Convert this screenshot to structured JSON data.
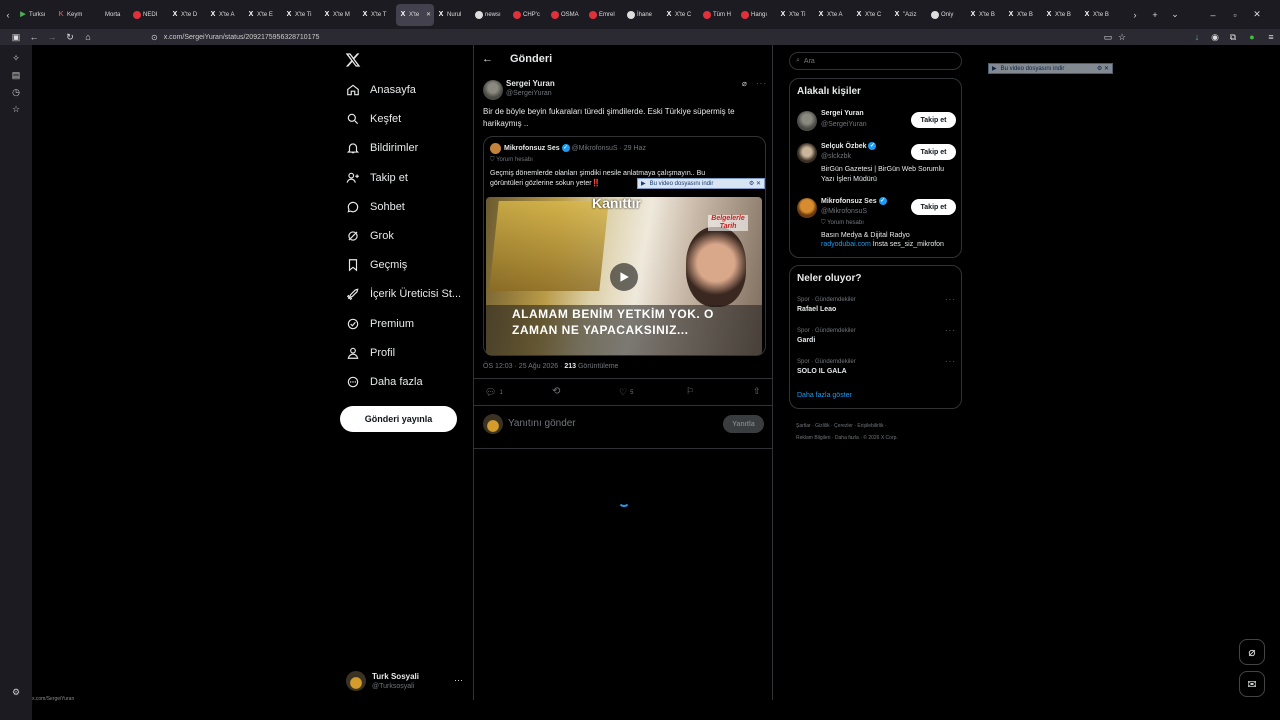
{
  "browser": {
    "tabs": [
      {
        "label": "Turksı",
        "icon": "app-icon"
      },
      {
        "label": "Keym",
        "icon": "k-icon"
      },
      {
        "label": "Morta",
        "icon": "blank-icon"
      },
      {
        "label": "NEDI",
        "icon": "red-icon"
      },
      {
        "label": "X'te D",
        "icon": "x-icon"
      },
      {
        "label": "X'te A",
        "icon": "x-icon"
      },
      {
        "label": "X'te E",
        "icon": "x-icon"
      },
      {
        "label": "X'te Ti",
        "icon": "x-icon"
      },
      {
        "label": "X'te M",
        "icon": "x-icon"
      },
      {
        "label": "X'te T",
        "icon": "x-icon"
      },
      {
        "label": "X'te",
        "icon": "x-icon",
        "active": true
      },
      {
        "label": "Nurul",
        "icon": "x-icon"
      },
      {
        "label": "newsı",
        "icon": "globe-icon"
      },
      {
        "label": "CHP'c",
        "icon": "red-icon"
      },
      {
        "label": "OSMA",
        "icon": "red-icon"
      },
      {
        "label": "Emrel",
        "icon": "red-icon"
      },
      {
        "label": "İhane",
        "icon": "globe-icon"
      },
      {
        "label": "X'te C",
        "icon": "x-icon"
      },
      {
        "label": "Tüm H",
        "icon": "red-icon"
      },
      {
        "label": "Hangı",
        "icon": "red-icon"
      },
      {
        "label": "X'te Ti",
        "icon": "x-icon"
      },
      {
        "label": "X'te A",
        "icon": "x-icon"
      },
      {
        "label": "X'te C",
        "icon": "x-icon"
      },
      {
        "label": "\"Aziz",
        "icon": "x-icon"
      },
      {
        "label": "Oniy",
        "icon": "globe-icon"
      },
      {
        "label": "X'te B",
        "icon": "x-icon"
      },
      {
        "label": "X'te B",
        "icon": "x-icon"
      },
      {
        "label": "X'te B",
        "icon": "x-icon"
      },
      {
        "label": "X'te B",
        "icon": "x-icon"
      }
    ],
    "url": "x.com/SergeiYuran/status/2092175956328710175",
    "status_url": "x.com/SergeiYuran"
  },
  "nav": {
    "items": [
      {
        "label": "Anasayfa",
        "icon": "home-icon"
      },
      {
        "label": "Keşfet",
        "icon": "search-icon"
      },
      {
        "label": "Bildirimler",
        "icon": "bell-icon"
      },
      {
        "label": "Takip et",
        "icon": "follow-icon"
      },
      {
        "label": "Sohbet",
        "icon": "chat-icon"
      },
      {
        "label": "Grok",
        "icon": "grok-icon"
      },
      {
        "label": "Geçmiş",
        "icon": "bookmark-icon"
      },
      {
        "label": "İçerik Üreticisi St...",
        "icon": "rocket-icon"
      },
      {
        "label": "Premium",
        "icon": "premium-icon"
      },
      {
        "label": "Profil",
        "icon": "profile-icon"
      },
      {
        "label": "Daha fazla",
        "icon": "more-icon"
      }
    ],
    "post_button": "Gönderi yayınla",
    "me": {
      "name": "Turk Sosyali",
      "handle": "@Turksosyali"
    }
  },
  "main": {
    "header": "Gönderi",
    "tweet": {
      "author": "Sergei Yuran",
      "handle": "@SergeiYuran",
      "text": "Bir de böyle beyin fukaraları türedi şimdilerde. Eski Türkiye süpermiş te harikaymış ..",
      "quote": {
        "author": "Mikrofonsuz Ses",
        "handle": "@MikrofonsuS",
        "date": "· 29 Haz",
        "label": "Yorum hesabı",
        "text": "Geçmiş dönemlerde olanları şimdiki nesile anlatmaya çalışmayın.. Bu görüntüleri gözlerine sokun yeter‼️",
        "video_caption_top": "Kanıttır",
        "video_caption_1": "ALAMAM BENİM YETKİM YOK. O",
        "video_caption_2": "ZAMAN NE YAPACAKSINIZ...",
        "video_logo": "Belgelerle Tarih"
      },
      "time": "ÖS 12:03 · 25 Ağu 2026 ·",
      "views": "213",
      "views_label": "Görüntüleme",
      "reply_count": "1",
      "like_count": "5"
    },
    "reply_placeholder": "Yanıtını gönder",
    "reply_button": "Yanıtla",
    "download_tip": "Bu video dosyasını indir"
  },
  "right": {
    "search_placeholder": "Ara",
    "people_title": "Alakalı kişiler",
    "people": [
      {
        "name": "Sergei Yuran",
        "handle": "@SergeiYuran",
        "bio": "",
        "button": "Takip et"
      },
      {
        "name": "Selçuk Özbek",
        "handle": "@slckzbk",
        "bio": "BirGün Gazetesi | BirGün Web Sorumlu Yazı İşleri Müdürü",
        "button": "Takip et"
      },
      {
        "name": "Mikrofonsuz Ses",
        "handle": "@MikrofonsuS",
        "tag": "Yorum hesabı",
        "bio": "Basın Medya & Dijital Radyo",
        "link": "radyodubai.com",
        "link_rest": " İnsta ses_siz_mikrofon",
        "button": "Takip et"
      }
    ],
    "trends_title": "Neler oluyor?",
    "trends": [
      {
        "context": "Spor · Gündemdekiler",
        "title": "Rafael Leao"
      },
      {
        "context": "Spor · Gündemdekiler",
        "title": "Gardi"
      },
      {
        "context": "Spor · Gündemdekiler",
        "title": "SOLO IL GALA"
      }
    ],
    "show_more": "Daha fazla göster",
    "footer_1": "Şartlar · Gizlilik · Çerezler · Erişilebilirlik ·",
    "footer_2": "Reklam Bilgileri · Daha fazla · © 2026 X Corp."
  },
  "colors": {
    "accent": "#1d9bf0",
    "bg": "#000000",
    "border": "#2f3336"
  }
}
